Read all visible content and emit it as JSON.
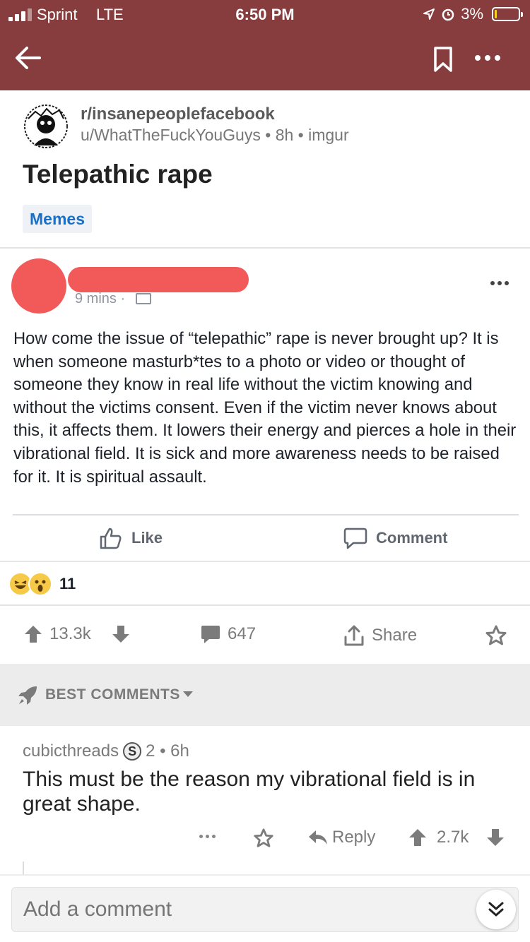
{
  "status_bar": {
    "carrier": "Sprint",
    "network": "LTE",
    "time": "6:50 PM",
    "battery": "3%",
    "battery_level": 0.03
  },
  "toolbar": {
    "back_icon": "back-arrow-icon",
    "save_icon": "bookmark-icon",
    "more_icon": "more-dots-icon"
  },
  "post": {
    "subreddit": "r/insanepeoplefacebook",
    "author": "u/WhatTheFuckYouGuys",
    "age": "8h",
    "source": "imgur",
    "title": "Telepathic rape",
    "flair": "Memes",
    "colors": {
      "header": "#873c3d",
      "flair_text": "#1a6fc7"
    }
  },
  "facebook_post": {
    "time": "9 mins ·",
    "body": "How come the issue of “telepathic” rape is never brought up? It is when someone masturb*tes to a photo or video or thought of someone they know in real life without the victim knowing and without the victims consent. Even if the victim never knows about this, it affects them. It lowers their energy and pierces a hole in their vibrational field. It is sick and more awareness needs to be raised for it. It is spiritual assault.",
    "like_label": "Like",
    "comment_label": "Comment",
    "reaction_count": "11"
  },
  "actions": {
    "score": "13.3k",
    "comments": "647",
    "share_label": "Share"
  },
  "best_comments": {
    "label": "BEST COMMENTS"
  },
  "comment": {
    "author": "cubicthreads",
    "badge": "S",
    "meta": "2 • 6h",
    "text": "This must be the reason my vibrational field is in great shape.",
    "reply_label": "Reply",
    "score": "2.7k"
  },
  "composer": {
    "placeholder": "Add a comment"
  }
}
